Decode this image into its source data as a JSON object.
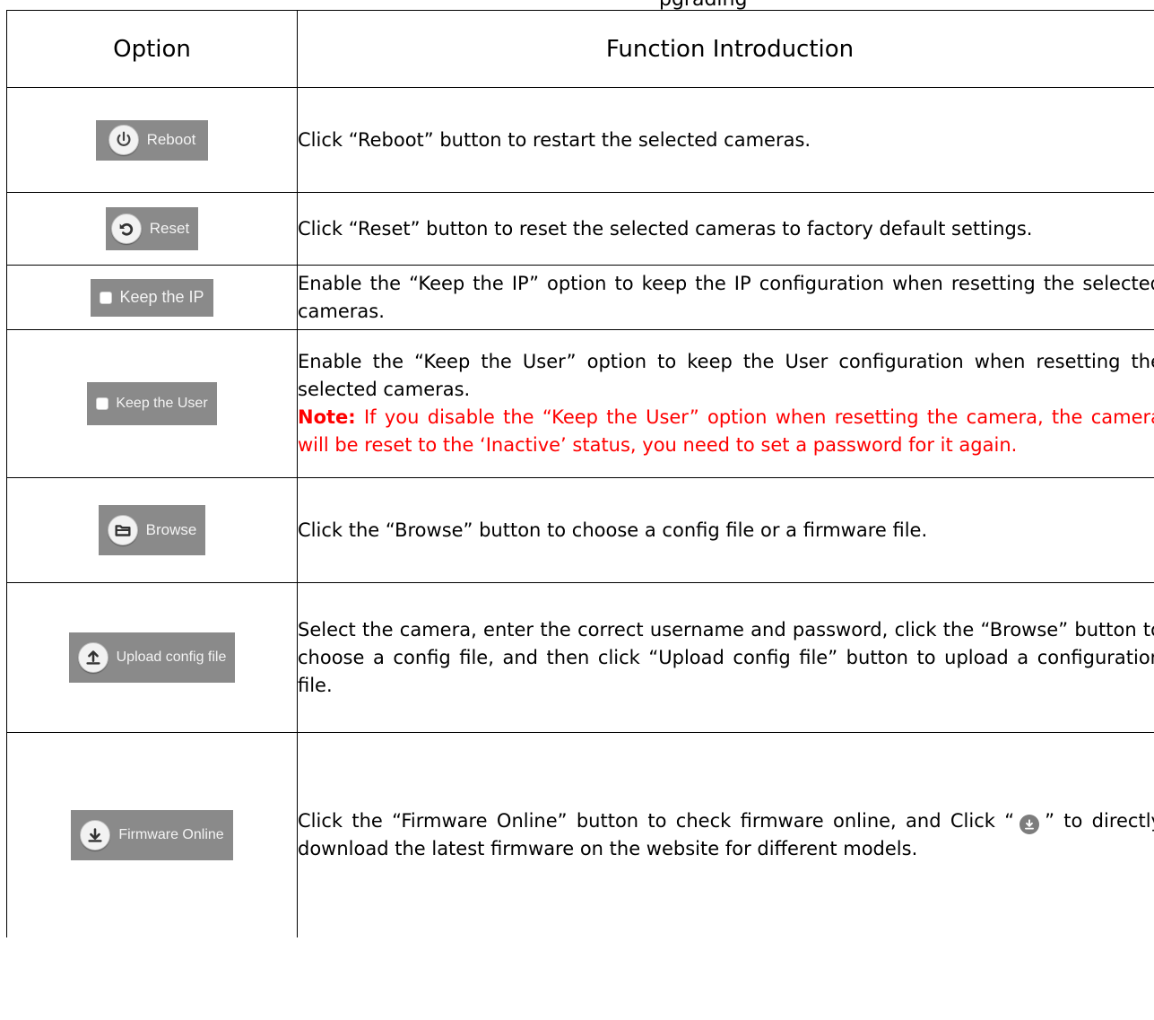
{
  "caption_fragment": "pgrading",
  "table": {
    "headers": [
      "Option",
      "Function Introduction"
    ],
    "rows": [
      {
        "button": "Reboot",
        "text": "Click “Reboot” button to restart the selected cameras."
      },
      {
        "button": "Reset",
        "text": "Click “Reset” button to reset the selected cameras to factory default settings."
      },
      {
        "button": "Keep the IP",
        "text": "Enable the “Keep the IP” option to keep the IP configuration when resetting the selected cameras."
      },
      {
        "button": "Keep the User",
        "text": "Enable the “Keep the User” option to keep the User configuration when resetting the selected cameras.",
        "note_label": "Note:",
        "note_text": " If you disable the “Keep the User” option when resetting the camera, the camera will be reset to the ‘Inactive’ status, you need to set a password for it again."
      },
      {
        "button": "Browse",
        "text": "Click the “Browse” button to choose a config file or a firmware file."
      },
      {
        "button": "Upload config file",
        "text": "Select the camera, enter the correct username and password, click the “Browse” button to choose a config file, and then click “Upload config file” button to upload a configuration file."
      },
      {
        "button": "Firmware Online",
        "text_before": "Click the “Firmware Online” button to check firmware online, and Click “",
        "text_after": "” to directly download the latest firmware on the website for different models."
      }
    ]
  },
  "icons": [
    "power-icon",
    "undo-icon",
    "checkbox-icon",
    "folder-icon",
    "upload-icon",
    "download-icon"
  ],
  "colors": {
    "button_bg": "#8a8a8a",
    "note": "#ff0000"
  }
}
